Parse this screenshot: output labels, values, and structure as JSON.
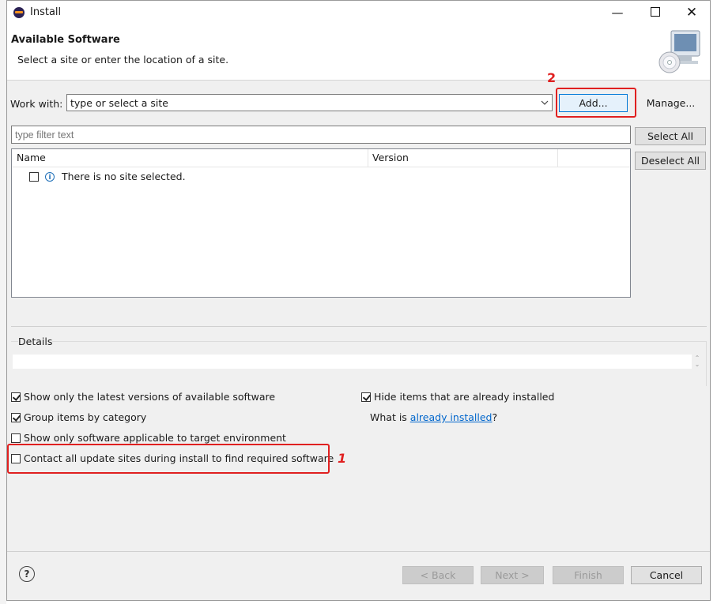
{
  "window": {
    "title": "Install",
    "minimize_glyph": "—",
    "close_glyph": "✕"
  },
  "header": {
    "title": "Available Software",
    "subtitle": "Select a site or enter the location of a site."
  },
  "work_with": {
    "label": "Work with:",
    "value": "type or select a site",
    "add_label": "Add...",
    "manage_label": "Manage..."
  },
  "filter": {
    "placeholder": "type filter text",
    "select_all_label": "Select All",
    "deselect_all_label": "Deselect All"
  },
  "tree": {
    "columns": [
      "Name",
      "Version"
    ],
    "rows": [
      {
        "checked": false,
        "icon": "info-icon",
        "text": "There is no site selected."
      }
    ]
  },
  "details": {
    "label": "Details",
    "text": ""
  },
  "options": {
    "latest": {
      "label": "Show only the latest versions of available software",
      "checked": true
    },
    "group": {
      "label": "Group items by category",
      "checked": true
    },
    "target": {
      "label": "Show only software applicable to target environment",
      "checked": false
    },
    "contact": {
      "label": "Contact all update sites during install to find required software",
      "checked": false
    },
    "hide": {
      "label": "Hide items that are already installed",
      "checked": true
    },
    "what_is_prefix": "What is ",
    "already_installed_link": "already installed",
    "what_is_suffix": "?"
  },
  "annotations": {
    "mark_add": "2",
    "mark_contact": "1",
    "color": "#e02020"
  },
  "footer": {
    "help_glyph": "?",
    "back_label": "< Back",
    "next_label": "Next >",
    "finish_label": "Finish",
    "cancel_label": "Cancel"
  },
  "colors": {
    "link": "#0066cc",
    "focus_button_border": "#0078d7",
    "dialog_bg": "#f0f0f0"
  }
}
